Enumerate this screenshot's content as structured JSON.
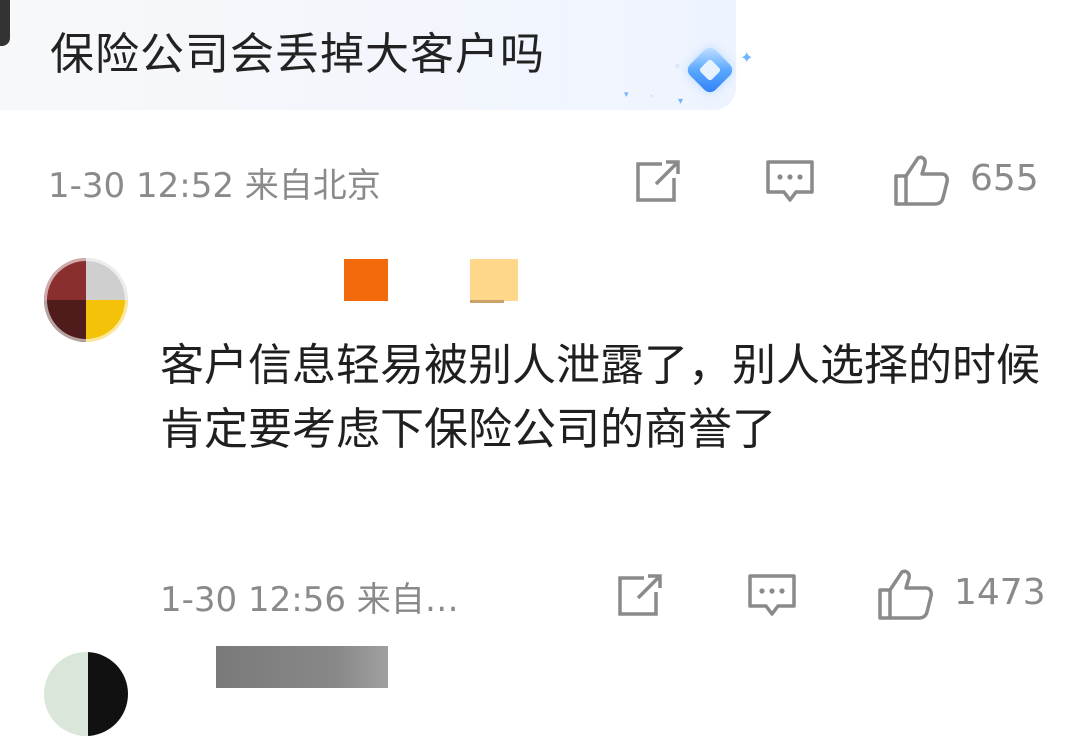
{
  "top_comment": {
    "text": "保险公司会丢掉大客户吗"
  },
  "comment1_meta": {
    "time": "1-30 12:52 来自北京",
    "likes": "655"
  },
  "reply": {
    "text": "客户信息轻易被别人泄露了，别人选择的时候肯定要考虑下保险公司的商誉了",
    "time": "1-30 12:56 来自…",
    "likes": "1473"
  },
  "colors": {
    "meta_gray": "#8a8a8a",
    "name_orange": "#f26a0c",
    "name_peach": "#ffd78a",
    "name_gray": "#7a7a7a"
  },
  "icons": [
    "share-icon",
    "comment-icon",
    "like-icon",
    "diamond-badge-icon"
  ]
}
